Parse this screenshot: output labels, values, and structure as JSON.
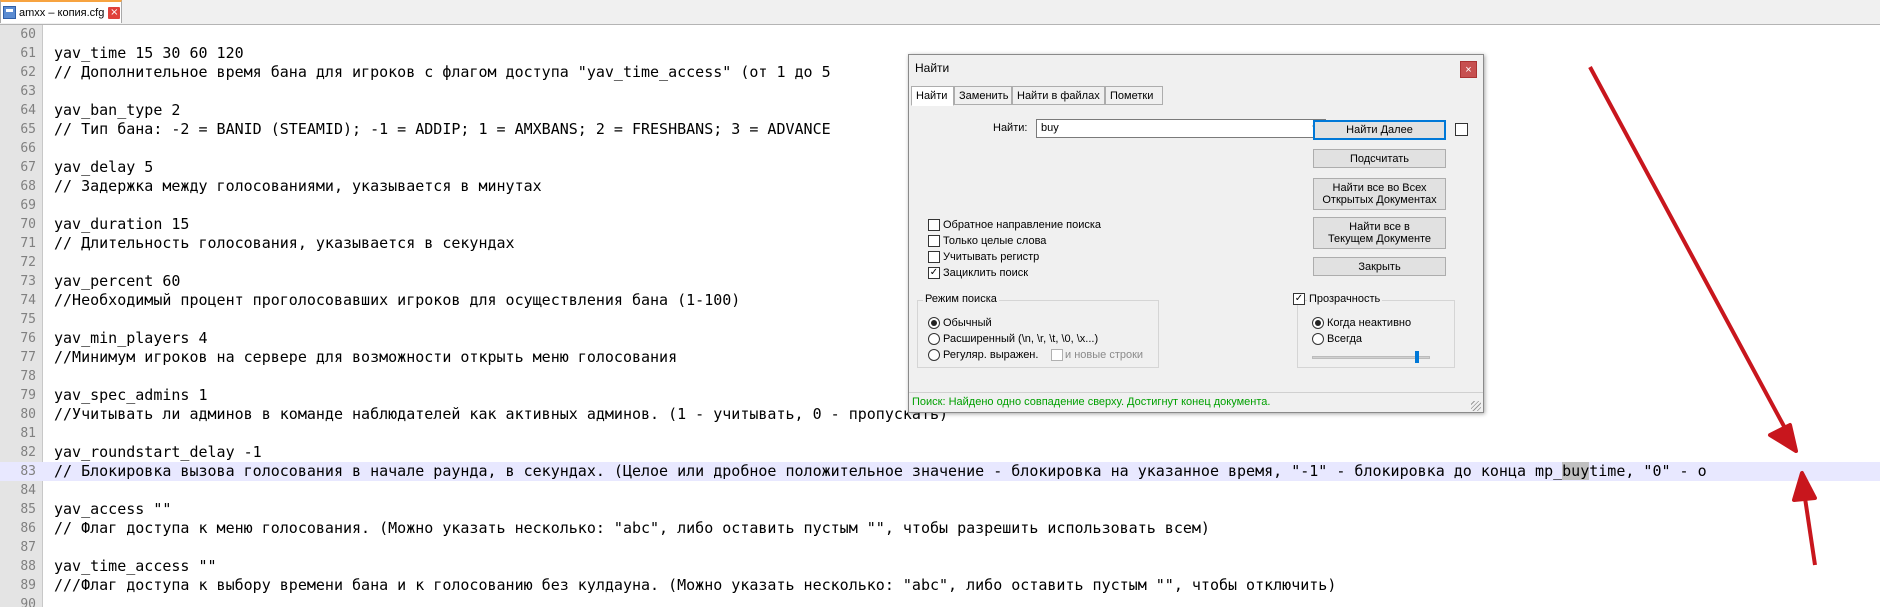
{
  "tab": {
    "title": "amxx – копия.cfg",
    "close_symbol": "×"
  },
  "editor": {
    "lines": [
      {
        "n": "60",
        "text": ""
      },
      {
        "n": "61",
        "text": "yav_time 15 30 60 120"
      },
      {
        "n": "62",
        "text": "// Дополнительное время бана для игроков с флагом доступа \"yav_time_access\" (от 1 до 5"
      },
      {
        "n": "63",
        "text": ""
      },
      {
        "n": "64",
        "text": "yav_ban_type 2"
      },
      {
        "n": "65",
        "text": "// Тип бана: -2 = BANID (STEAMID); -1 = ADDIP; 1 = AMXBANS; 2 = FRESHBANS; 3 = ADVANCE"
      },
      {
        "n": "66",
        "text": ""
      },
      {
        "n": "67",
        "text": "yav_delay 5"
      },
      {
        "n": "68",
        "text": "// Задержка между голосованиями, указывается в минутах"
      },
      {
        "n": "69",
        "text": ""
      },
      {
        "n": "70",
        "text": "yav_duration 15"
      },
      {
        "n": "71",
        "text": "// Длительность голосования, указывается в секундах"
      },
      {
        "n": "72",
        "text": ""
      },
      {
        "n": "73",
        "text": "yav_percent 60"
      },
      {
        "n": "74",
        "text": "//Необходимый процент проголосовавших игроков для осуществления бана (1-100)"
      },
      {
        "n": "75",
        "text": ""
      },
      {
        "n": "76",
        "text": "yav_min_players 4"
      },
      {
        "n": "77",
        "text": "//Минимум игроков на сервере для возможности открыть меню голосования"
      },
      {
        "n": "78",
        "text": ""
      },
      {
        "n": "79",
        "text": "yav_spec_admins 1"
      },
      {
        "n": "80",
        "text": "//Учитывать ли админов в команде наблюдателей как активных админов. (1 - учитывать, 0 - пропускать)"
      },
      {
        "n": "81",
        "text": ""
      },
      {
        "n": "82",
        "text": "yav_roundstart_delay -1"
      },
      {
        "n": "83",
        "text": "// Блокировка вызова голосования в начале раунда, в секундах. (Целое или дробное положительное значение - блокировка на указанное время, \"-1\" - блокировка до конца mp_",
        "match": "buy",
        "after": "time, \"0\" - о"
      },
      {
        "n": "84",
        "text": ""
      },
      {
        "n": "85",
        "text": "yav_access \"\""
      },
      {
        "n": "86",
        "text": "// Флаг доступа к меню голосования. (Можно указать несколько: \"abc\", либо оставить пустым \"\", чтобы разрешить использовать всем)"
      },
      {
        "n": "87",
        "text": ""
      },
      {
        "n": "88",
        "text": "yav_time_access \"\""
      },
      {
        "n": "89",
        "text": "///Флаг доступа к выбору времени бана и к голосованию без кулдауна. (Можно указать несколько: \"abc\", либо оставить пустым \"\", чтобы отключить)"
      },
      {
        "n": "90",
        "text": ""
      }
    ],
    "active_line": "83"
  },
  "find_dialog": {
    "title": "Найти",
    "close_symbol": "×",
    "tabs": [
      "Найти",
      "Заменить",
      "Найти в файлах",
      "Пометки"
    ],
    "find_label": "Найти:",
    "find_value": "buy",
    "buttons": {
      "find_next": "Найти Далее",
      "count": "Подсчитать",
      "find_all_open_1": "Найти все во Всех",
      "find_all_open_2": "Открытых Документах",
      "find_all_current_1": "Найти все в",
      "find_all_current_2": "Текущем Документе",
      "close": "Закрыть"
    },
    "options": {
      "backward": "Обратное направление поиска",
      "whole_word": "Только целые слова",
      "match_case": "Учитывать регистр",
      "wrap": "Зациклить поиск"
    },
    "search_mode": {
      "title": "Режим поиска",
      "normal": "Обычный",
      "extended": "Расширенный (\\n, \\r, \\t, \\0, \\x...)",
      "regex": "Регуляр. выражен.",
      "newline": "и новые строки"
    },
    "transparency": {
      "title": "Прозрачность",
      "on_lose_focus": "Когда неактивно",
      "always": "Всегда",
      "level": 0.9
    },
    "status": "Поиск: Найдено одно совпадение сверху. Достигнут конец документа."
  }
}
